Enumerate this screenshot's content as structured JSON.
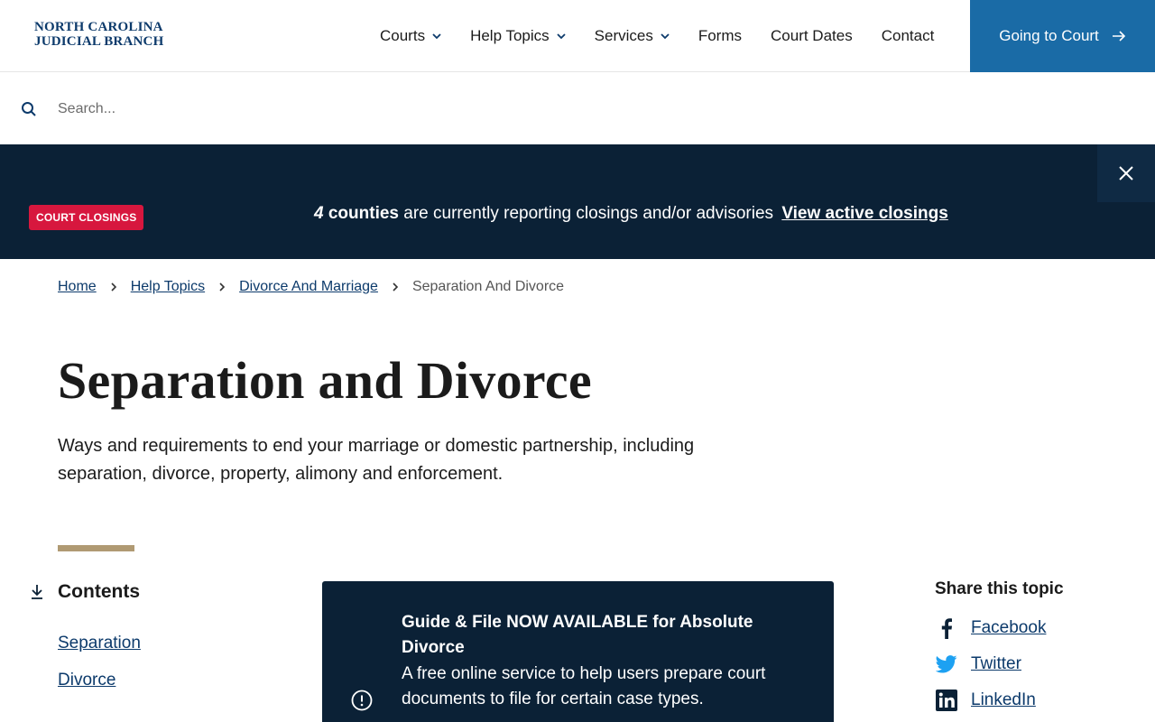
{
  "header": {
    "logo_line1": "NORTH CAROLINA",
    "logo_line2": "JUDICIAL BRANCH",
    "nav": [
      {
        "label": "Courts",
        "dropdown": true
      },
      {
        "label": "Help Topics",
        "dropdown": true
      },
      {
        "label": "Services",
        "dropdown": true
      },
      {
        "label": "Forms",
        "dropdown": false
      },
      {
        "label": "Court Dates",
        "dropdown": false
      },
      {
        "label": "Contact",
        "dropdown": false
      }
    ],
    "cta_label": "Going to Court",
    "cta_icon": "arrow-right-icon",
    "cta_color": "#1a6ba6"
  },
  "search": {
    "placeholder": "Search...",
    "value": ""
  },
  "alert": {
    "badge": "COURT CLOSINGS",
    "count": "4",
    "strong": "counties",
    "text": "are currently reporting closings and/or advisories",
    "link": "View active closings",
    "bg_color": "#0b2136",
    "badge_color": "#d7173e"
  },
  "breadcrumb": {
    "items": [
      "Home",
      "Help Topics",
      "Divorce And Marriage"
    ],
    "current": "Separation And Divorce"
  },
  "page": {
    "title": "Separation and Divorce",
    "lede": "Ways and requirements to end your marriage or domestic partnership, including separation, divorce, property, alimony and enforcement."
  },
  "contents": {
    "title": "Contents",
    "items": [
      "Separation",
      "Divorce"
    ]
  },
  "guide": {
    "title": "Guide & File NOW AVAILABLE for Absolute Divorce",
    "body": "A free online service to help users prepare court documents to file for certain case types."
  },
  "share": {
    "title": "Share this topic",
    "items": [
      {
        "label": "Facebook",
        "icon": "facebook-icon"
      },
      {
        "label": "Twitter",
        "icon": "twitter-icon"
      },
      {
        "label": "LinkedIn",
        "icon": "linkedin-icon"
      }
    ]
  }
}
